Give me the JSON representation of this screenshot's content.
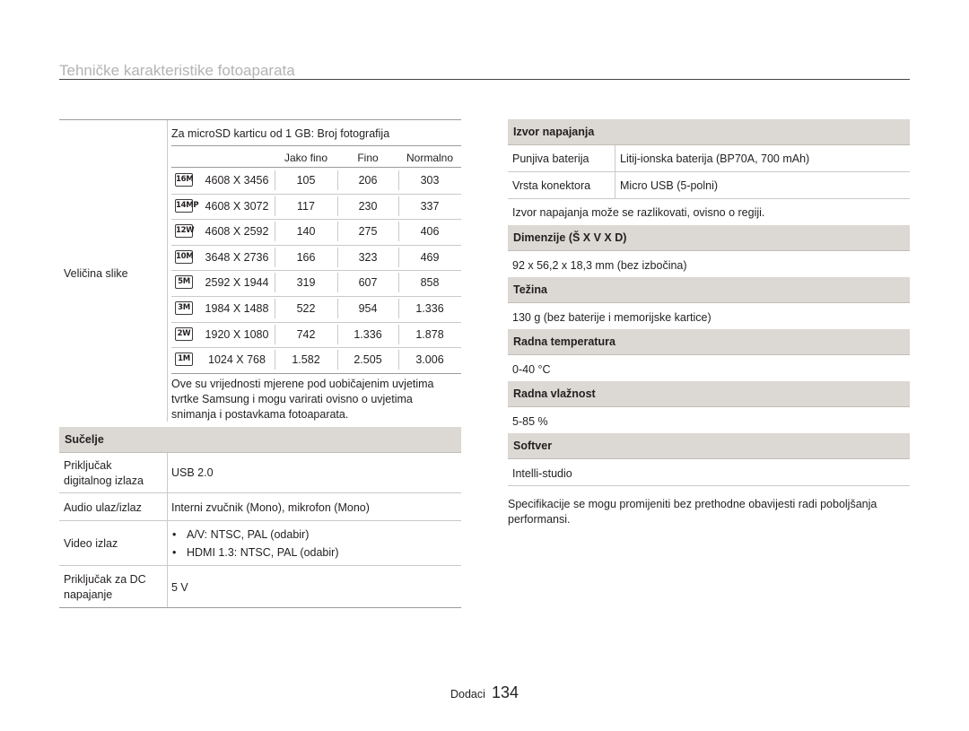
{
  "header": {
    "title": "Tehničke karakteristike fotoaparata"
  },
  "image_size": {
    "label": "Veličina slike",
    "note_title": "Za microSD karticu od 1 GB: Broj fotografija",
    "columns": [
      "Jako fino",
      "Fino",
      "Normalno"
    ],
    "rows": [
      {
        "icon": "16M",
        "icon_name": "resolution-16m-icon",
        "res": "4608 X 3456",
        "v1": "105",
        "v2": "206",
        "v3": "303"
      },
      {
        "icon": "14MP",
        "icon_name": "resolution-14m-wide-icon",
        "res": "4608 X 3072",
        "v1": "117",
        "v2": "230",
        "v3": "337"
      },
      {
        "icon": "12W",
        "icon_name": "resolution-12m-wide-icon",
        "res": "4608 X 2592",
        "v1": "140",
        "v2": "275",
        "v3": "406"
      },
      {
        "icon": "10M",
        "icon_name": "resolution-10m-icon",
        "res": "3648 X 2736",
        "v1": "166",
        "v2": "323",
        "v3": "469"
      },
      {
        "icon": "5M",
        "icon_name": "resolution-5m-icon",
        "res": "2592 X 1944",
        "v1": "319",
        "v2": "607",
        "v3": "858"
      },
      {
        "icon": "3M",
        "icon_name": "resolution-3m-icon",
        "res": "1984 X 1488",
        "v1": "522",
        "v2": "954",
        "v3": "1.336"
      },
      {
        "icon": "2W",
        "icon_name": "resolution-2m-wide-icon",
        "res": "1920 X 1080",
        "v1": "742",
        "v2": "1.336",
        "v3": "1.878"
      },
      {
        "icon": "1M",
        "icon_name": "resolution-1m-icon",
        "res": "1024 X 768",
        "v1": "1.582",
        "v2": "2.505",
        "v3": "3.006"
      }
    ],
    "footnote_lines": [
      "Ove su vrijednosti mjerene pod uobičajenim uvjetima",
      "tvrtke Samsung i mogu varirati ovisno o uvjetima",
      "snimanja i postavkama fotoaparata."
    ]
  },
  "interface": {
    "heading": "Sučelje",
    "digital_out": {
      "label_l1": "Priključak",
      "label_l2": "digitalnog izlaza",
      "value": "USB 2.0"
    },
    "audio": {
      "label": "Audio ulaz/izlaz",
      "value": "Interni zvučnik (Mono), mikrofon (Mono)"
    },
    "video": {
      "label": "Video izlaz",
      "bullet": "•",
      "value1": "A/V: NTSC, PAL (odabir)",
      "value2": "HDMI 1.3: NTSC, PAL (odabir)"
    },
    "dc": {
      "label_l1": "Priključak za DC",
      "label_l2": "napajanje",
      "value": "5 V"
    }
  },
  "power": {
    "heading": "Izvor napajanja",
    "battery_label": "Punjiva baterija",
    "battery_value": "Litij-ionska baterija (BP70A, 700 mAh)",
    "connector_label": "Vrsta konektora",
    "connector_value": "Micro USB (5-polni)",
    "note": "Izvor napajanja može se razlikovati, ovisno o regiji."
  },
  "dimensions": {
    "heading": "Dimenzije (Š X V X D)",
    "value": "92 x 56,2 x 18,3 mm (bez izbočina)"
  },
  "weight": {
    "heading": "Težina",
    "value": "130 g (bez baterije i memorijske kartice)"
  },
  "temperature": {
    "heading": "Radna temperatura",
    "value": "0-40 °C"
  },
  "humidity": {
    "heading": "Radna vlažnost",
    "value": "5-85 %"
  },
  "software": {
    "heading": "Softver",
    "value": "Intelli-studio"
  },
  "disclaimer": {
    "line1": "Specifikacije se mogu promijeniti bez prethodne obavijesti radi poboljšanja",
    "line2": "performansi."
  },
  "footer": {
    "section": "Dodaci",
    "page": "134"
  }
}
